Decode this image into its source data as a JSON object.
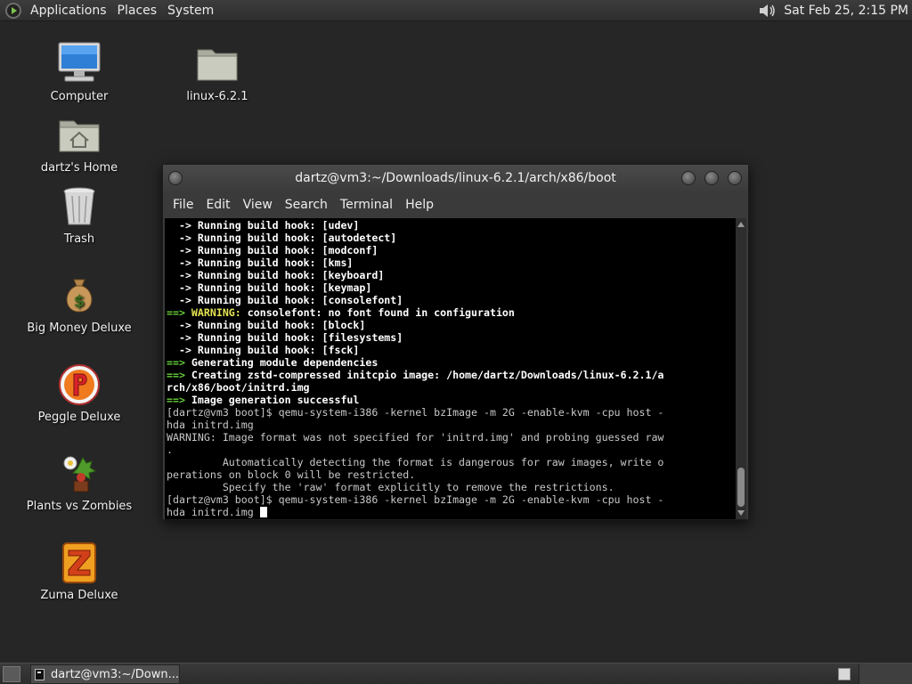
{
  "top_panel": {
    "menus": [
      "Applications",
      "Places",
      "System"
    ],
    "clock": "Sat Feb 25,  2:15 PM"
  },
  "desktop": {
    "icons": [
      {
        "label": "Computer",
        "icon": "computer-icon"
      },
      {
        "label": "linux-6.2.1",
        "icon": "folder-icon"
      },
      {
        "label": "dartz's Home",
        "icon": "home-folder-icon"
      },
      {
        "label": "Trash",
        "icon": "trash-icon"
      },
      {
        "label": "Big Money Deluxe",
        "icon": "money-bag-icon"
      },
      {
        "label": "Peggle Deluxe",
        "icon": "peggle-icon"
      },
      {
        "label": "Plants vs Zombies",
        "icon": "plant-icon"
      },
      {
        "label": "Zuma Deluxe",
        "icon": "zuma-icon"
      }
    ]
  },
  "terminal": {
    "title": "dartz@vm3:~/Downloads/linux-6.2.1/arch/x86/boot",
    "menus": [
      "File",
      "Edit",
      "View",
      "Search",
      "Terminal",
      "Help"
    ],
    "lines": [
      [
        {
          "c": "w",
          "t": "  -> Running build hook: [udev]"
        }
      ],
      [
        {
          "c": "w",
          "t": "  -> Running build hook: [autodetect]"
        }
      ],
      [
        {
          "c": "w",
          "t": "  -> Running build hook: [modconf]"
        }
      ],
      [
        {
          "c": "w",
          "t": "  -> Running build hook: [kms]"
        }
      ],
      [
        {
          "c": "w",
          "t": "  -> Running build hook: [keyboard]"
        }
      ],
      [
        {
          "c": "w",
          "t": "  -> Running build hook: [keymap]"
        }
      ],
      [
        {
          "c": "w",
          "t": "  -> Running build hook: [consolefont]"
        }
      ],
      [
        {
          "c": "g",
          "t": "==> "
        },
        {
          "c": "y",
          "t": "WARNING: "
        },
        {
          "c": "w",
          "t": "consolefont: no font found in configuration"
        }
      ],
      [
        {
          "c": "w",
          "t": "  -> Running build hook: [block]"
        }
      ],
      [
        {
          "c": "w",
          "t": "  -> Running build hook: [filesystems]"
        }
      ],
      [
        {
          "c": "w",
          "t": "  -> Running build hook: [fsck]"
        }
      ],
      [
        {
          "c": "g",
          "t": "==> "
        },
        {
          "c": "w",
          "t": "Generating module dependencies"
        }
      ],
      [
        {
          "c": "g",
          "t": "==> "
        },
        {
          "c": "w",
          "t": "Creating zstd-compressed initcpio image: /home/dartz/Downloads/linux-6.2.1/a"
        }
      ],
      [
        {
          "c": "w",
          "t": "rch/x86/boot/initrd.img"
        }
      ],
      [
        {
          "c": "g",
          "t": "==> "
        },
        {
          "c": "w",
          "t": "Image generation successful"
        }
      ],
      [
        {
          "c": "p",
          "t": "[dartz@vm3 boot]$ qemu-system-i386 -kernel bzImage -m 2G -enable-kvm -cpu host -"
        }
      ],
      [
        {
          "c": "p",
          "t": "hda initrd.img"
        }
      ],
      [
        {
          "c": "p",
          "t": "WARNING: Image format was not specified for 'initrd.img' and probing guessed raw"
        }
      ],
      [
        {
          "c": "p",
          "t": "."
        }
      ],
      [
        {
          "c": "p",
          "t": "         Automatically detecting the format is dangerous for raw images, write o"
        }
      ],
      [
        {
          "c": "p",
          "t": "perations on block 0 will be restricted."
        }
      ],
      [
        {
          "c": "p",
          "t": "         Specify the 'raw' format explicitly to remove the restrictions."
        }
      ],
      [
        {
          "c": "p",
          "t": "[dartz@vm3 boot]$ qemu-system-i386 -kernel bzImage -m 2G -enable-kvm -cpu host -"
        }
      ],
      [
        {
          "c": "p",
          "t": "hda initrd.img "
        }
      ]
    ]
  },
  "taskbar": {
    "items": [
      {
        "label": "dartz@vm3:~/Down...",
        "icon": "terminal-icon"
      }
    ]
  }
}
